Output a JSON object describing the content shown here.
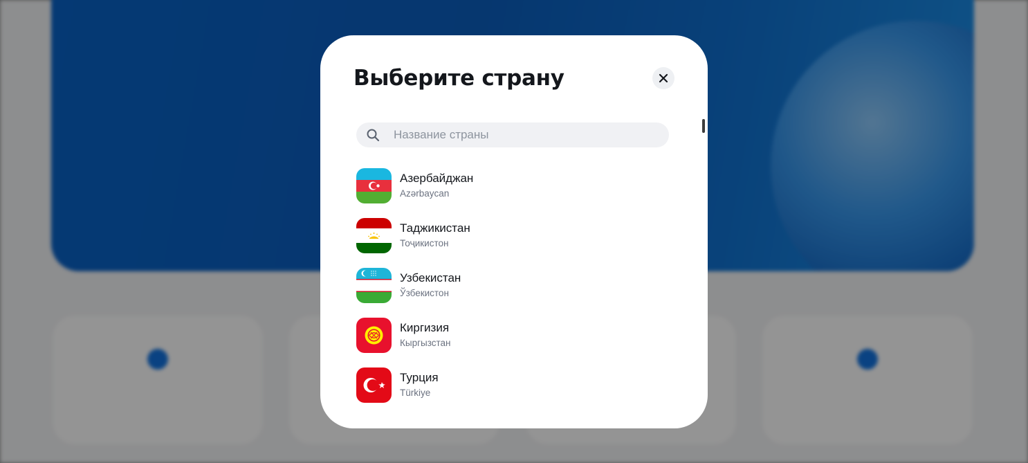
{
  "modal": {
    "title": "Выберите страну",
    "close_icon": "close-icon"
  },
  "search": {
    "icon": "search-icon",
    "placeholder": "Название страны",
    "value": ""
  },
  "countries": [
    {
      "name": "Азербайджан",
      "native": "Azərbaycan",
      "flag_icon": "azerbaijan-flag-icon"
    },
    {
      "name": "Таджикистан",
      "native": "Тоҷикистон",
      "flag_icon": "tajikistan-flag-icon"
    },
    {
      "name": "Узбекистан",
      "native": "Ўзбекистон",
      "flag_icon": "uzbekistan-flag-icon"
    },
    {
      "name": "Киргизия",
      "native": "Кыргызстан",
      "flag_icon": "kyrgyzstan-flag-icon"
    },
    {
      "name": "Турция",
      "native": "Türkiye",
      "flag_icon": "turkey-flag-icon"
    }
  ],
  "colors": {
    "overlay": "#8c8c8c",
    "hero_blue": "#0b5fc0",
    "modal_bg": "#ffffff",
    "title_text": "#14171c",
    "secondary_text": "#6b7280",
    "search_bg": "#f0f1f4"
  }
}
